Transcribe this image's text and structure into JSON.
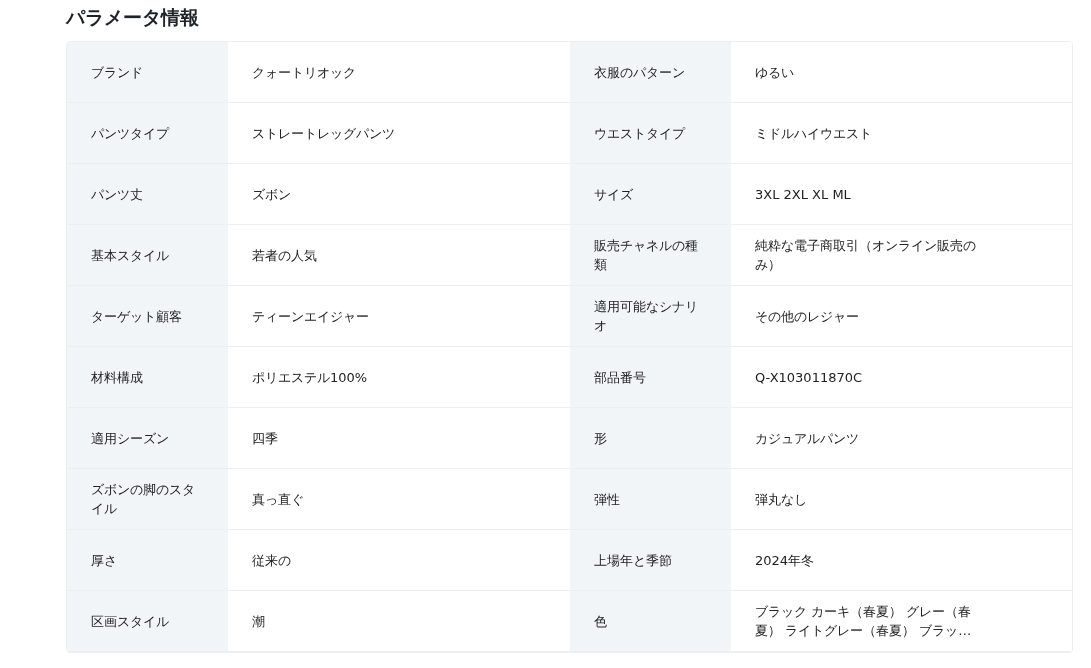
{
  "title": "パラメータ情報",
  "rows": [
    {
      "left": {
        "label": "ブランド",
        "value": "クォートリオック"
      },
      "right": {
        "label": "衣服のパターン",
        "value": "ゆるい"
      }
    },
    {
      "left": {
        "label": "パンツタイプ",
        "value": "ストレートレッグパンツ"
      },
      "right": {
        "label": "ウエストタイプ",
        "value": "ミドルハイウエスト"
      }
    },
    {
      "left": {
        "label": "パンツ丈",
        "value": "ズボン"
      },
      "right": {
        "label": "サイズ",
        "value": "3XL 2XL XL ML"
      }
    },
    {
      "left": {
        "label": "基本スタイル",
        "value": "若者の人気"
      },
      "right": {
        "label": "販売チャネルの種類",
        "value": "純粋な電子商取引（オンライン販売のみ）"
      }
    },
    {
      "left": {
        "label": "ターゲット顧客",
        "value": "ティーンエイジャー"
      },
      "right": {
        "label": "適用可能なシナリオ",
        "value": "その他のレジャー"
      }
    },
    {
      "left": {
        "label": "材料構成",
        "value": "ポリエステル100%"
      },
      "right": {
        "label": "部品番号",
        "value": "Q-X103011870C"
      }
    },
    {
      "left": {
        "label": "適用シーズン",
        "value": "四季"
      },
      "right": {
        "label": "形",
        "value": "カジュアルパンツ"
      }
    },
    {
      "left": {
        "label": "ズボンの脚のスタイル",
        "value": "真っ直ぐ"
      },
      "right": {
        "label": "弾性",
        "value": "弾丸なし"
      }
    },
    {
      "left": {
        "label": "厚さ",
        "value": "従来の"
      },
      "right": {
        "label": "上場年と季節",
        "value": "2024年冬"
      }
    },
    {
      "left": {
        "label": "区画スタイル",
        "value": "潮"
      },
      "right": {
        "label": "色",
        "value": "ブラック カーキ（春夏） グレー（春夏） ライトグレー（春夏） ブラッ…"
      }
    }
  ]
}
